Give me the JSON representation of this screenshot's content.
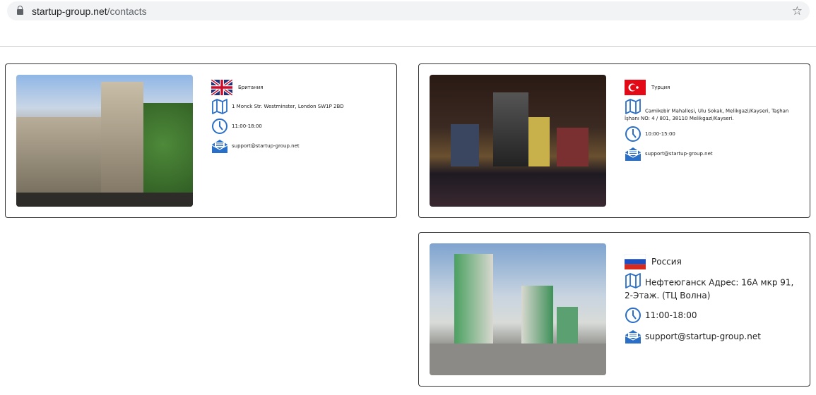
{
  "browser": {
    "domain": "startup-group.net",
    "path": "/contacts"
  },
  "offices": [
    {
      "country": "Британия",
      "address": "1 Monck Str. Westminster, London SW1P 2BD",
      "hours": "11:00-18:00",
      "email": "support@startup-group.net"
    },
    {
      "country": "Турция",
      "address": "Camikebir Mahallesi, Ulu Sokak, Melikgazi/Kayseri, Taşhan İşhanı NO: 4 / 801, 38110 Melikgazi/Kayseri.",
      "hours": "10:00-15:00",
      "email": "support@startup-group.net"
    },
    {
      "country": "Россия",
      "address": "Нефтеюганск Адрес: 16А мкр 91, 2-Этаж. (ТЦ Волна)",
      "hours": "11:00-18:00",
      "email": "support@startup-group.net"
    }
  ],
  "colors": {
    "icon": "#2a6fc7"
  }
}
